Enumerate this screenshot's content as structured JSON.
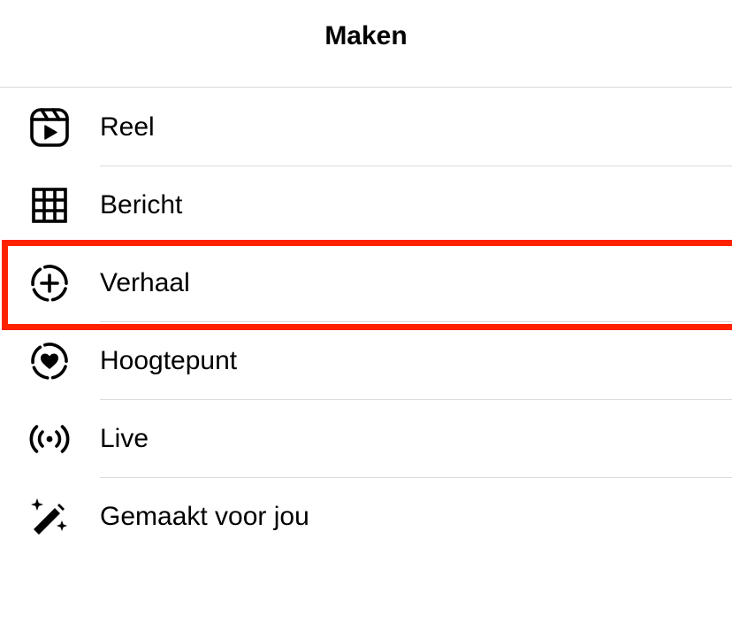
{
  "header": {
    "title": "Maken"
  },
  "menu": {
    "items": [
      {
        "label": "Reel",
        "icon": "reel-icon"
      },
      {
        "label": "Bericht",
        "icon": "grid-icon"
      },
      {
        "label": "Verhaal",
        "icon": "story-add-icon"
      },
      {
        "label": "Hoogtepunt",
        "icon": "highlight-heart-icon"
      },
      {
        "label": "Live",
        "icon": "live-broadcast-icon"
      },
      {
        "label": "Gemaakt voor jou",
        "icon": "magic-wand-icon"
      }
    ],
    "selected": "Verhaal"
  },
  "colors": {
    "highlight_border": "#ff2200",
    "divider": "#dbdbdb",
    "text": "#000000",
    "background": "#ffffff"
  }
}
